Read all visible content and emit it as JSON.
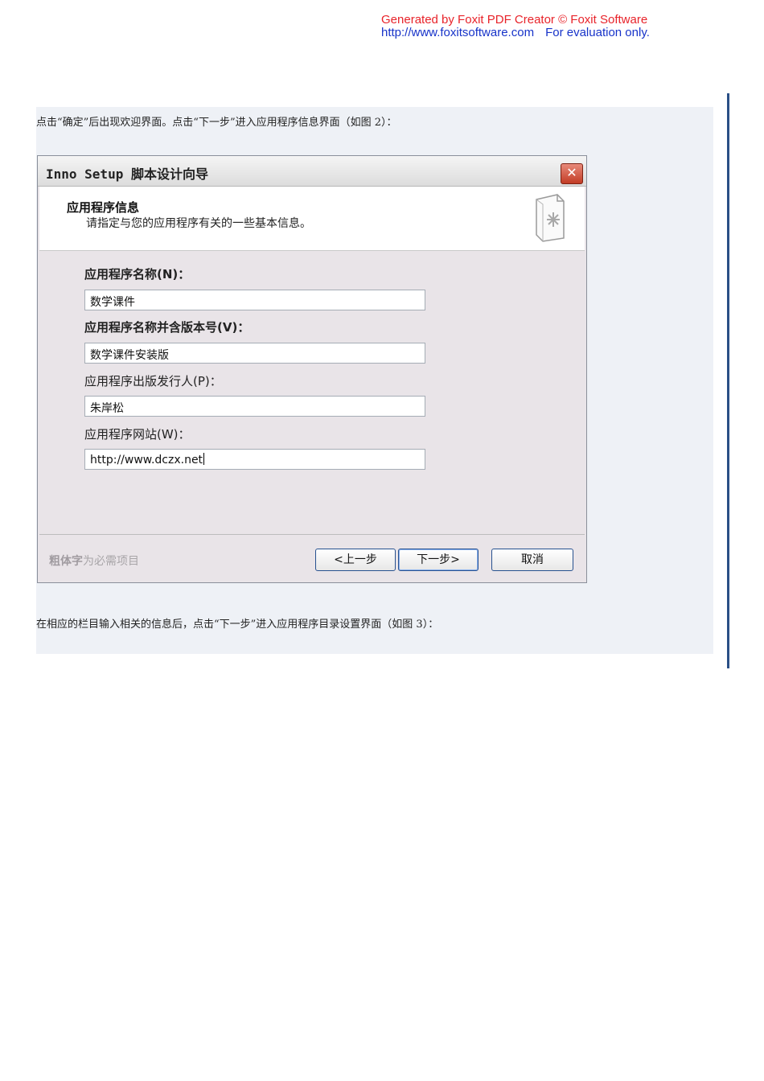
{
  "watermark": {
    "line1": "Generated by Foxit PDF Creator © Foxit Software",
    "url": "http://www.foxitsoftware.com",
    "note": "For evaluation only."
  },
  "paragraphs": {
    "intro": "点击“确定”后出现欢迎界面。点击“下一步”进入应用程序信息界面（如图 2）：",
    "outro": "在相应的栏目输入相关的信息后，点击“下一步”进入应用程序目录设置界面（如图 3）："
  },
  "dialog": {
    "title": "Inno Setup 脚本设计向导",
    "close_glyph": "✕",
    "header": {
      "title": "应用程序信息",
      "subtitle": "请指定与您的应用程序有关的一些基本信息。"
    },
    "fields": [
      {
        "label": "应用程序名称(N)：",
        "value": "数学课件"
      },
      {
        "label": "应用程序名称并含版本号(V)：",
        "value": "数学课件安装版"
      },
      {
        "label": "应用程序出版发行人(P)：",
        "value": "朱岸松"
      },
      {
        "label": "应用程序网站(W)：",
        "value": "http://www.dczx.net"
      }
    ],
    "footer_note": {
      "bold_part": "粗体字",
      "rest": "为必需项目"
    },
    "buttons": {
      "prev": "<上一步",
      "next": "下一步>",
      "cancel": "取消"
    }
  },
  "icons": {
    "header_icon": "document-asterisk-icon",
    "close_icon": "close-icon"
  },
  "colors": {
    "watermark_red": "#e8232a",
    "watermark_blue": "#1733c9",
    "close_red": "#c23c25"
  }
}
